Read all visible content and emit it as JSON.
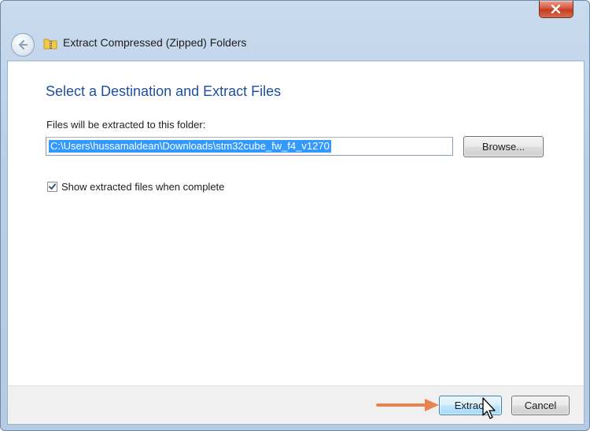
{
  "window": {
    "title": "Extract Compressed (Zipped) Folders",
    "close_icon": "close-icon",
    "back_icon": "back-arrow-icon",
    "folder_icon": "zip-folder-icon"
  },
  "main": {
    "heading": "Select a Destination and Extract Files",
    "field_label": "Files will be extracted to this folder:",
    "destination_path": "C:\\Users\\hussamaldean\\Downloads\\stm32cube_fw_f4_v1270",
    "browse_label": "Browse...",
    "show_files_checkbox": {
      "label": "Show extracted files when complete",
      "checked": true
    }
  },
  "footer": {
    "extract_label": "Extract",
    "cancel_label": "Cancel"
  },
  "colors": {
    "heading": "#1f4f9c",
    "selection": "#3399ff",
    "annotation_arrow": "#e8834e"
  }
}
